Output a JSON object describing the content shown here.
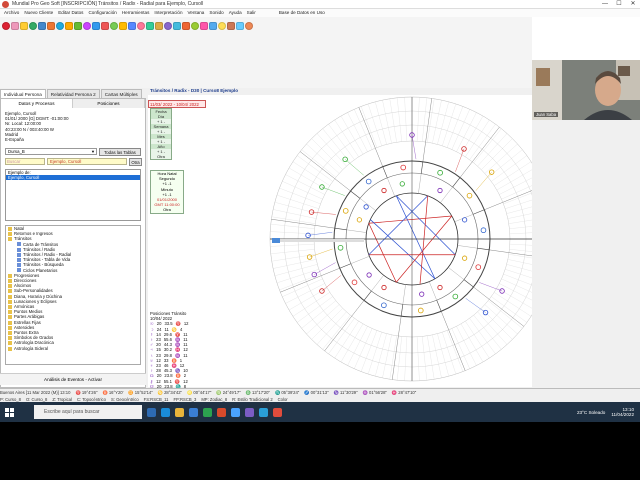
{
  "window": {
    "title": "Mundial Pro Geo Soft [INSCRIPCIÓN] Tránsitos / Radix - Radial para Ejemplo, Cursoll",
    "controls": [
      "—",
      "☐",
      "✕"
    ]
  },
  "menu": [
    "Archivo",
    "Nuevo Cliente",
    "Editar Datos",
    "Configuración",
    "Herramientas",
    "Interpretación",
    "Ventana",
    "Sonido",
    "Ayuda",
    "Salir",
    "Base de Datos en Uso"
  ],
  "tabs": [
    "Individual Persona",
    "Relatividad Persona 2",
    "Cartas Múltiples"
  ],
  "subtabs": [
    "Datos y Procesos",
    "Posiciones"
  ],
  "person": {
    "lines": [
      "Ejemplo, Cursoll",
      "01/01/ 2000 [G]   DGMT: -01:00:00",
      "Nr. Local: 12:00:00",
      "40:23:00 N / 003:40:00 W",
      "Madrid",
      "E-España"
    ]
  },
  "combo_value": "Dursa_B",
  "all_tables_btn": "Todas las Tablas",
  "search_placeholder": "Buscar",
  "search_value": "Ejemplo, Cursoll",
  "search_btn": "Otra",
  "list": {
    "label": "Ejemplo de:",
    "selected": "Ejemplo, Cursoll"
  },
  "tree": [
    "Natal",
    "Retornos e Ingresos",
    "Tránsitos",
    "Carta de Tránsitos",
    "Tránsitos / Radix",
    "Tránsitos / Radix - Radial",
    "Tránsitos - Tabla de Vida",
    "Tránsitos - Búsqueda",
    "Ciclos Planetarios",
    "Progresiones",
    "Direcciones",
    "Alscimos",
    "Sub-Personalidades",
    "Diana, Horaria y Dúchina",
    "Lunaciones y Eclipses",
    "Armónicas",
    "Puntos Medios",
    "Partes Arábigas",
    "Estrellas Fijas",
    "Asteroides",
    "Puntos Extra",
    "Símbolos de Grados",
    "Astrología Dracónica",
    "Astrología Sideral"
  ],
  "tree_levels": [
    0,
    0,
    0,
    1,
    1,
    1,
    1,
    1,
    1,
    0,
    0,
    0,
    0,
    0,
    0,
    0,
    0,
    0,
    0,
    0,
    0,
    0,
    0,
    0
  ],
  "bottom_btn": "Análisis de Eventos - Activar",
  "chart_title": "Tránsitos / Radix - D30 | Curso8 Ejemplo",
  "date_range": "11/03/ 2022 - 10/04/ 2022",
  "side": [
    {
      "h": "Fecha"
    },
    {
      "h": "Día"
    },
    {
      "b": "+  1  -"
    },
    {
      "h": "Semana"
    },
    {
      "b": "+  1  -"
    },
    {
      "h": "Mes"
    },
    {
      "b": "+  1  -"
    },
    {
      "h": "Año"
    },
    {
      "b": "+  1  -"
    },
    {
      "b": "Otra"
    }
  ],
  "now": {
    "title": "Hora Natal",
    "sub": "Segundo",
    "row": "+1  -1",
    "label2": "Minuto",
    "row2": "+1  -1",
    "date": "01/01/2000",
    "gmt": "GMT 11:00:00",
    "btn": "Otra"
  },
  "positions": {
    "header": "Posiciones Tránsito",
    "date": "10/04/ 2022",
    "rows": [
      [
        "☉",
        "20",
        "33.5",
        "♈",
        "12"
      ],
      [
        "☽",
        "24",
        "11",
        "♋",
        "4"
      ],
      [
        "☿",
        "14",
        "29.6",
        "♈",
        "11"
      ],
      [
        "♀",
        "23",
        "55.6",
        "♒",
        "11"
      ],
      [
        "♂",
        "20",
        "44.3",
        "♒",
        "11"
      ],
      [
        "♃",
        "15",
        "30.2",
        "♓",
        "12"
      ],
      [
        "♄",
        "23",
        "29.8",
        "♒",
        "11"
      ],
      [
        "♅",
        "12",
        "33",
        "♉",
        "1"
      ],
      [
        "♆",
        "23",
        "46",
        "♓",
        "12"
      ],
      [
        "♇",
        "28",
        "45.3",
        "♑",
        "10"
      ],
      [
        "☊",
        "20",
        "23.8",
        "♉",
        "2"
      ],
      [
        "⚷",
        "12",
        "55.1",
        "♈",
        "12"
      ],
      [
        "☋",
        "20",
        "23.8",
        "♏",
        "8"
      ]
    ]
  },
  "status_line1": [
    "Buenos Aires [11 Mar 2022 (M)] 13:10",
    "♈ 19°4'26\"",
    "♉ 16°Y20'",
    "♊ 15°52'14\"",
    "♋ 28°34'42\"",
    "♌ 00°44'17\"",
    "♍ 24°49'17\"",
    "♎ 13°17'20\"",
    "♏ 05°39'24\"",
    "♐ 00°31'13\"",
    "♑ 11°30'29\"",
    "♒ 01°56'28\"",
    "♓ 28°47'10\""
  ],
  "status_line2": [
    "P: Curso_8",
    "O: Curso_8",
    "Z: Tropical",
    "C: Topocéntrico",
    "S: Geocéntrico",
    "FS:RSCB_11",
    "FP:RSCB_3",
    "MP: Zodiac_8",
    "R: Estilo Tradicional 2",
    "Color"
  ],
  "webcam": {
    "name": "Juan Saba"
  },
  "taskbar": {
    "search": "Escribe aquí para buscar",
    "weather": "23°C Soleado",
    "time": "13:10",
    "date": "11/04/2022"
  },
  "colors": {
    "accent": "#1e6fd6",
    "title_blue": "#1d3c8b",
    "red": "#c22",
    "taskbar": "#1f3144"
  }
}
